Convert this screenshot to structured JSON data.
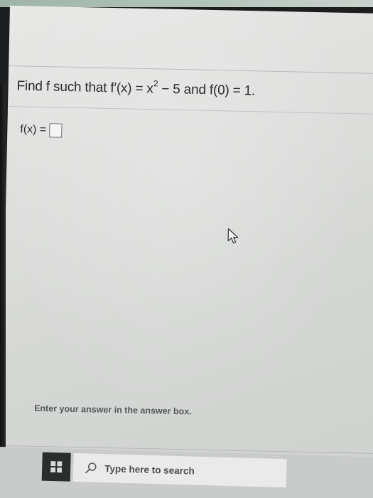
{
  "question": {
    "lead": "Find f such that f′(x) = x",
    "exponent": "2",
    "rest": " − 5 and f(0) = 1."
  },
  "answer": {
    "label": "f(x) ="
  },
  "hint": {
    "text": "Enter your answer in the answer box."
  },
  "taskbar": {
    "search_placeholder": "Type here to search"
  },
  "icons": {
    "cursor": "mouse-pointer-icon",
    "start": "windows-start-icon",
    "search": "search-icon"
  },
  "colors": {
    "page_background": "#dfe0de",
    "text": "#2a2b2d",
    "answer_box_border": "#6a7076",
    "taskbar": "#c9cbca"
  }
}
